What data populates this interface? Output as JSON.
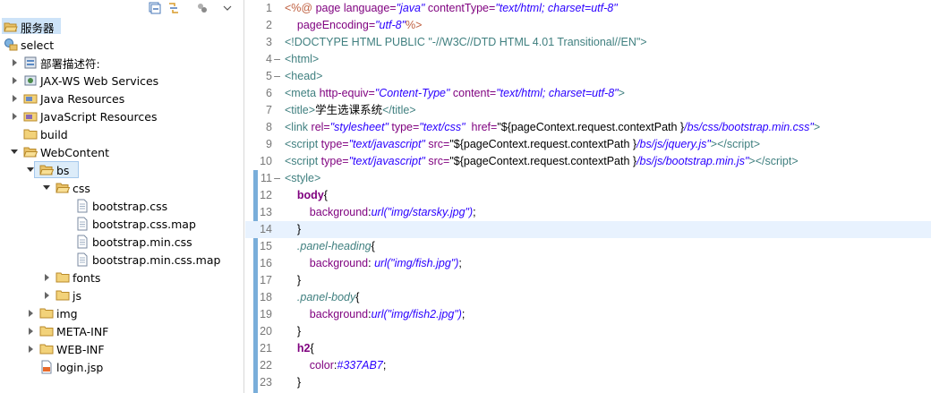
{
  "explorer": {
    "server_label": "服务器",
    "project_label": "select",
    "items": [
      {
        "label": "部署描述符:"
      },
      {
        "label": "JAX-WS Web Services"
      },
      {
        "label": "Java Resources"
      },
      {
        "label": "JavaScript Resources"
      },
      {
        "label": "build"
      },
      {
        "label": "WebContent"
      },
      {
        "label": "bs"
      },
      {
        "label": "css"
      },
      {
        "label": "bootstrap.css"
      },
      {
        "label": "bootstrap.css.map"
      },
      {
        "label": "bootstrap.min.css"
      },
      {
        "label": "bootstrap.min.css.map"
      },
      {
        "label": "fonts"
      },
      {
        "label": "js"
      },
      {
        "label": "img"
      },
      {
        "label": "META-INF"
      },
      {
        "label": "WEB-INF"
      },
      {
        "label": "login.jsp"
      }
    ]
  },
  "editor": {
    "line_numbers": [
      "1",
      "2",
      "3",
      "4",
      "5",
      "6",
      "7",
      "8",
      "9",
      "10",
      "11",
      "12",
      "13",
      "14",
      "15",
      "16",
      "17",
      "18",
      "19",
      "20",
      "21",
      "22",
      "23"
    ],
    "lines": {
      "l1": {
        "a": "<%@ ",
        "b": "page ",
        "c": "language=",
        "d": "\"java\"",
        "e": " contentType=",
        "f": "\"text/html; charset=utf-8\""
      },
      "l2": {
        "a": "    pageEncoding=",
        "b": "\"utf-8\"",
        "c": "%>"
      },
      "l3": {
        "a": "<!DOCTYPE HTML PUBLIC ",
        "b": "\"-//W3C//DTD HTML 4.01 Transitional//EN\"",
        "c": ">"
      },
      "l4": {
        "a": "<html>"
      },
      "l5": {
        "a": "<head>"
      },
      "l6": {
        "a": "<meta ",
        "b": "http-equiv=",
        "c": "\"Content-Type\"",
        "d": " content=",
        "e": "\"text/html; charset=utf-8\"",
        "f": ">"
      },
      "l7": {
        "a": "<title>",
        "b": "学生选课系统",
        "c": "</title>"
      },
      "l8": {
        "a": "<link ",
        "b": "rel=",
        "c": "\"stylesheet\"",
        "d": " type=",
        "e": "\"text/css\"",
        "f": "  href=",
        "g": "\"${pageContext.request.contextPath }",
        "h": "/bs/css/bootstrap.min.css\"",
        "i": ">"
      },
      "l9": {
        "a": "<script ",
        "b": "type=",
        "c": "\"text/javascript\"",
        "d": " src=",
        "e": "\"${pageContext.request.contextPath }",
        "f": "/bs/js/jquery.js\"",
        "g": "></",
        "h": "script",
        "i": ">"
      },
      "l10": {
        "a": "<script ",
        "b": "type=",
        "c": "\"text/javascript\"",
        "d": " src=",
        "e": "\"${pageContext.request.contextPath }",
        "f": "/bs/js/bootstrap.min.js\"",
        "g": "></",
        "h": "script",
        "i": ">"
      },
      "l11": {
        "a": "<style>"
      },
      "l12": {
        "a": "    ",
        "b": "body",
        "c": "{"
      },
      "l13": {
        "a": "        ",
        "b": "background",
        ":": ":",
        "c": "url(\"img/starsky.jpg\")",
        "d": ";"
      },
      "l14": {
        "a": "    }"
      },
      "l15": {
        "a": "    ",
        "b": ".panel-heading",
        "c": "{"
      },
      "l16": {
        "a": "        ",
        "b": "background",
        ":": ": ",
        "c": "url(\"img/fish.jpg\")",
        "d": ";"
      },
      "l17": {
        "a": "    }"
      },
      "l18": {
        "a": "    ",
        "b": ".panel-body",
        "c": "{"
      },
      "l19": {
        "a": "        ",
        "b": "background",
        ":": ":",
        "c": "url(\"img/fish2.jpg\")",
        "d": ";"
      },
      "l20": {
        "a": "    }"
      },
      "l21": {
        "a": "    ",
        "b": "h2",
        "c": "{"
      },
      "l22": {
        "a": "        ",
        "b": "color",
        ":": ":",
        "c": "#337AB7",
        "d": ";"
      },
      "l23": {
        "a": "    }"
      }
    }
  }
}
